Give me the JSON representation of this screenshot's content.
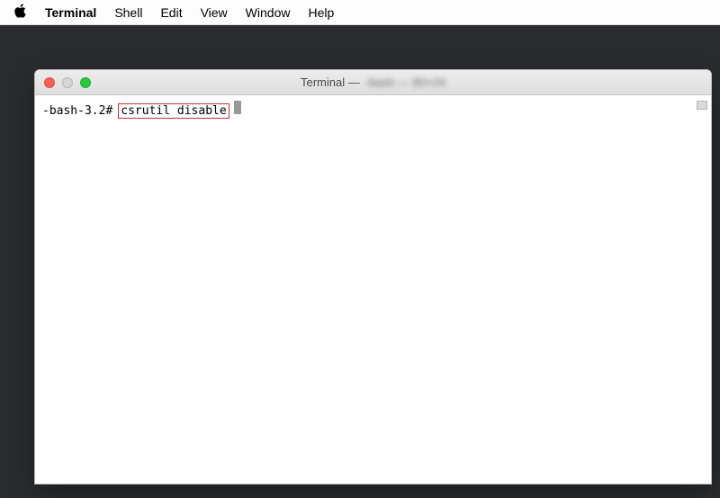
{
  "menubar": {
    "app_name": "Terminal",
    "items": [
      "Shell",
      "Edit",
      "View",
      "Window",
      "Help"
    ]
  },
  "window": {
    "title_prefix": "Terminal —",
    "title_blurred": "-bash — 80×24"
  },
  "terminal": {
    "prompt": "-bash-3.2#",
    "command": "csrutil disable"
  },
  "icons": {
    "apple": "apple-logo",
    "close": "close-icon",
    "minimize": "minimize-icon",
    "zoom": "zoom-icon"
  }
}
